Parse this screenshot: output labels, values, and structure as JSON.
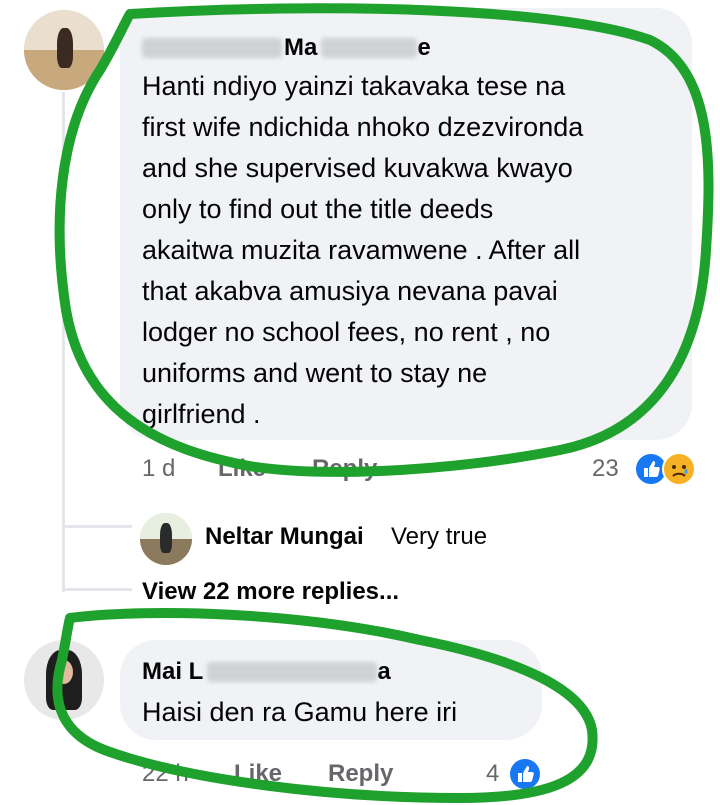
{
  "comment1": {
    "author_visible": "Ma",
    "author_visible_end": "e",
    "lines": [
      "Hanti ndiyo yainzi takavaka tese na",
      "first wife ndichida nhoko dzezvironda",
      "and she supervised kuvakwa kwayo",
      "only to find out the title deeds",
      "akaitwa muzita ravamwene . After all",
      "that akabva amusiya nevana pavai",
      "lodger no school fees, no rent , no",
      "uniforms  and went to stay ne",
      "girlfriend ."
    ],
    "time": "1 d",
    "like_label": "Like",
    "reply_label": "Reply",
    "reaction_count": "23"
  },
  "reply1": {
    "author": "Neltar Mungai",
    "text": "Very true"
  },
  "view_more_label": "View 22 more replies...",
  "comment2": {
    "author_visible": "Mai L",
    "author_visible_end": "a",
    "text": "Haisi den ra Gamu here iri",
    "time": "22 h",
    "like_label": "Like",
    "reply_label": "Reply",
    "reaction_count": "4"
  },
  "colors": {
    "bubble": "#f0f2f5",
    "marker": "#1fa12d",
    "like": "#1877f2",
    "meta": "#65676b"
  }
}
